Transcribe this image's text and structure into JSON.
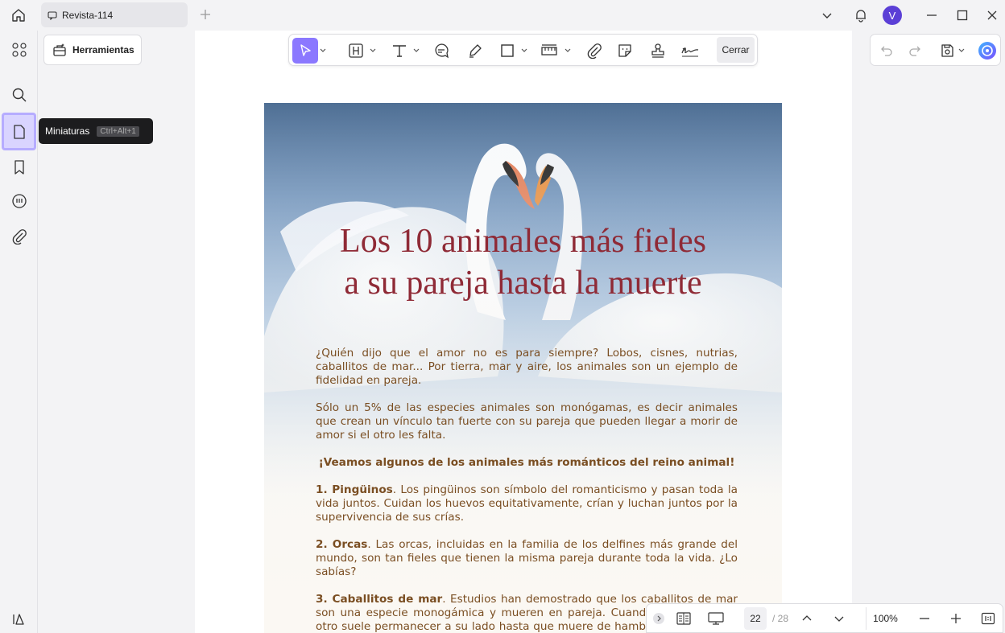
{
  "window": {
    "tab_title": "Revista-114",
    "user_initial": "V",
    "colors": {
      "accent": "#8b78ff",
      "title_red": "#8f2a36",
      "body_brown": "#7a4e22"
    }
  },
  "panel": {
    "tools_label": "Herramientas",
    "tooltip_label": "Miniaturas",
    "tooltip_shortcut": "Ctrl+Alt+1"
  },
  "toolbar": {
    "close_label": "Cerrar"
  },
  "page": {
    "title_line1": "Los 10 animales más fieles",
    "title_line2": "a su pareja hasta la muerte",
    "p1": "¿Quién dijo que el amor no es para siempre? Lobos, cisnes, nutrias, caballitos de mar... Por tierra, mar y aire, los animales son un ejemplo de fidelidad en pareja.",
    "p2": "Sólo un 5% de las especies animales son monógamas, es decir animales que crean un vínculo tan fuerte con su pareja que pueden llegar a morir de amor si el otro les falta.",
    "p3": "¡Veamos algunos de los animales más románticos del reino animal!",
    "item1_title": "1. Pingüinos",
    "item1_text": ". Los pingüinos son símbolo del romanticismo y pasan toda la vida juntos. Cuidan los huevos equitativamente, crían y luchan juntos por la supervivencia de sus crías.",
    "item2_title": "2. Orcas",
    "item2_text": ". Las orcas, incluidas en la familia de los delfines más grande del mundo, son tan fieles que tienen la misma pareja durante toda la vida. ¿Lo sabías?",
    "item3_title": "3. Caballitos de mar",
    "item3_text": ". Estudios han demostrado que los caballitos de mar son una especie monogámica y mueren en pareja. Cuando uno muere, el otro suele permanecer a su lado hasta que muere de hambre. Como Romeo y Julieta, mueren literalmente de amor."
  },
  "bottombar": {
    "current_page": "22",
    "total_pages": "/ 28",
    "zoom": "100%"
  }
}
